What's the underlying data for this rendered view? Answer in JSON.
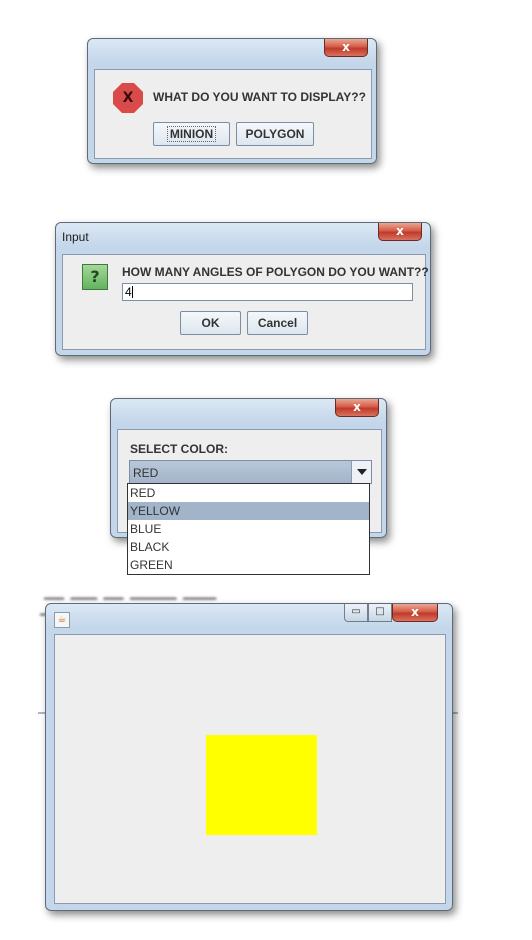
{
  "dialog_display": {
    "close_label": "x",
    "icon": "error-icon",
    "icon_glyph": "X",
    "message": "WHAT DO YOU WANT TO DISPLAY??",
    "buttons": [
      "MINION",
      "POLYGON"
    ]
  },
  "dialog_input": {
    "title": "Input",
    "close_label": "x",
    "icon": "question-icon",
    "icon_glyph": "?",
    "message": "HOW MANY ANGLES OF POLYGON DO YOU WANT??",
    "input_value": "4",
    "ok_label": "OK",
    "cancel_label": "Cancel"
  },
  "dialog_color": {
    "close_label": "x",
    "label": "SELECT COLOR:",
    "selected_value": "RED",
    "options": [
      "RED",
      "YELLOW",
      "BLUE",
      "BLACK",
      "GREEN"
    ],
    "highlighted_option": "YELLOW"
  },
  "canvas_window": {
    "minimize_glyph": "▭",
    "maximize_glyph": "□",
    "close_label": "x",
    "app_icon": "java-icon",
    "shape": "square",
    "shape_color": "#ffff00",
    "background_color": "#eeeeee"
  }
}
